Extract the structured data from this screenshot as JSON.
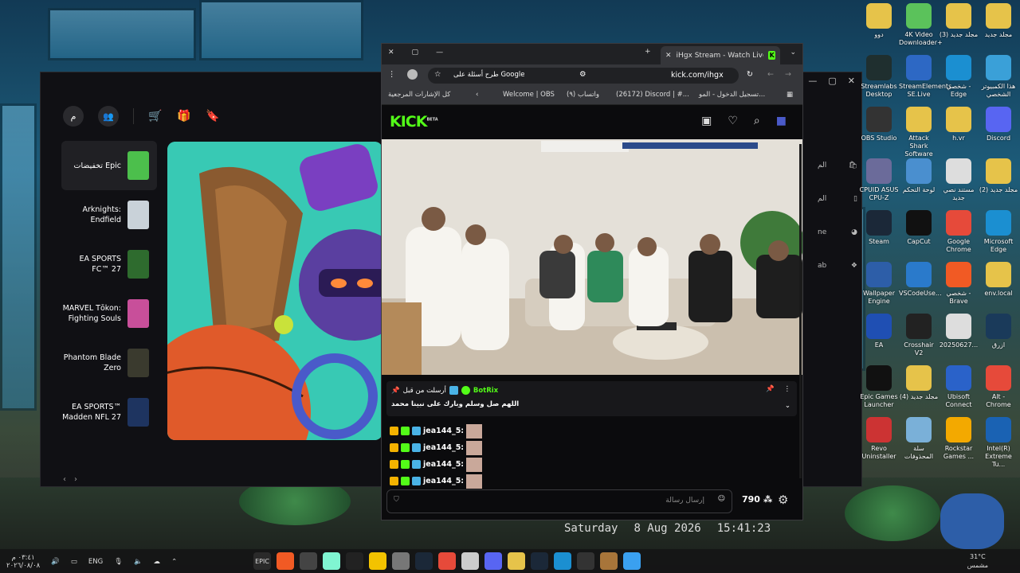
{
  "epic": {
    "avatar_initial": "م",
    "sidebar": [
      {
        "label": "تخفيضات Epic",
        "color": "#4cbf4c"
      },
      {
        "label": "Arknights: Endfield",
        "color": "#c9d2d9"
      },
      {
        "label": "EA SPORTS FC™ 27",
        "color": "#2e6b2e"
      },
      {
        "label": "MARVEL Tōkon: Fighting Souls",
        "color": "#c84f9a"
      },
      {
        "label": "Phantom Blade Zero",
        "color": "#3a3a2e"
      },
      {
        "label": "EA SPORTS™ Madden NFL 27",
        "color": "#1e3460"
      }
    ],
    "right_nav": [
      "الم",
      "الم",
      "ne",
      "ab"
    ],
    "window_controls": [
      "—",
      "▢",
      "✕"
    ]
  },
  "chrome": {
    "tab_title": "iHgx Stream - Watch Live on Ki",
    "url": "kick.com/ihgx",
    "google_chip": "طرح أسئلة على Google",
    "bookmarks": [
      "كل الإشارات المرجعية",
      "Welcome | OBS",
      "(٩) واتساب",
      "(26172) Discord | #...",
      "تسجيل الدخول - المو..."
    ],
    "window_controls": [
      "✕",
      "▢",
      "—"
    ]
  },
  "kick": {
    "logo": "KICK",
    "logo_badge": "BETA",
    "pinned": {
      "pinned_by": "أرسلت من قبل",
      "bot": "BotRix",
      "message": "اللهم صل وسلم وبارك على نبينا محمد"
    },
    "chat": [
      {
        "user": "jea144_5:"
      },
      {
        "user": "jea144_5:"
      },
      {
        "user": "jea144_5:"
      },
      {
        "user": "jea144_5:"
      }
    ],
    "input_placeholder": "إرسال رسالة",
    "viewers": "790"
  },
  "desktop_icons": [
    {
      "label": "دوو",
      "color": "#e6c34a",
      "col": 0,
      "row": 0
    },
    {
      "label": "4K Video Downloader+",
      "color": "#5bc25b",
      "col": 1,
      "row": 0
    },
    {
      "label": "(3) مجلد جديد",
      "color": "#e6c34a",
      "col": 2,
      "row": 0
    },
    {
      "label": "مجلد جديد",
      "color": "#e6c34a",
      "col": 3,
      "row": 0
    },
    {
      "label": "Streamlabs Desktop",
      "color": "#1f2f2f",
      "col": 0,
      "row": 1
    },
    {
      "label": "StreamElements SE.Live",
      "color": "#2d68c4",
      "col": 1,
      "row": 1
    },
    {
      "label": "شخصي - Edge",
      "color": "#1b8fd1",
      "col": 2,
      "row": 1
    },
    {
      "label": "هذا الكمبيوتر الشخصي",
      "color": "#3aa0d8",
      "col": 3,
      "row": 1
    },
    {
      "label": "OBS Studio",
      "color": "#333",
      "col": 0,
      "row": 2
    },
    {
      "label": "Attack Shark Software",
      "color": "#e6c34a",
      "col": 1,
      "row": 2
    },
    {
      "label": "h.vr",
      "color": "#e6c34a",
      "col": 2,
      "row": 2
    },
    {
      "label": "Discord",
      "color": "#5865f2",
      "col": 3,
      "row": 2
    },
    {
      "label": "CPUID ASUS CPU-Z",
      "color": "#6b6b9a",
      "col": 0,
      "row": 3
    },
    {
      "label": "لوحة التحكم",
      "color": "#4a8fcf",
      "col": 1,
      "row": 3
    },
    {
      "label": "مستند نصي جديد",
      "color": "#ddd",
      "col": 2,
      "row": 3
    },
    {
      "label": "(2) مجلد جديد",
      "color": "#e6c34a",
      "col": 3,
      "row": 3
    },
    {
      "label": "Steam",
      "color": "#1b2838",
      "col": 0,
      "row": 4
    },
    {
      "label": "CapCut",
      "color": "#111",
      "col": 1,
      "row": 4
    },
    {
      "label": "Google Chrome",
      "color": "#e64a3a",
      "col": 2,
      "row": 4
    },
    {
      "label": "Microsoft Edge",
      "color": "#1b8fd1",
      "col": 3,
      "row": 4
    },
    {
      "label": "Wallpaper Engine",
      "color": "#2d5ea8",
      "col": 0,
      "row": 5
    },
    {
      "label": "VSCodeUse...",
      "color": "#2a7acb",
      "col": 1,
      "row": 5
    },
    {
      "label": "شخصي - Brave",
      "color": "#f15a24",
      "col": 2,
      "row": 5
    },
    {
      "label": "env.local",
      "color": "#e6c34a",
      "col": 3,
      "row": 5
    },
    {
      "label": "EA",
      "color": "#1f4fb3",
      "col": 0,
      "row": 6
    },
    {
      "label": "Crosshair V2",
      "color": "#222",
      "col": 1,
      "row": 6
    },
    {
      "label": "20250627...",
      "color": "#ddd",
      "col": 2,
      "row": 6
    },
    {
      "label": "ازرق",
      "color": "#1a3a5a",
      "col": 3,
      "row": 6
    },
    {
      "label": "Epic Games Launcher",
      "color": "#111",
      "col": 0,
      "row": 7
    },
    {
      "label": "(4) مجلد جديد",
      "color": "#e6c34a",
      "col": 1,
      "row": 7
    },
    {
      "label": "Ubisoft Connect",
      "color": "#2a62c9",
      "col": 2,
      "row": 7
    },
    {
      "label": "Alt - Chrome",
      "color": "#e64a3a",
      "col": 3,
      "row": 7
    },
    {
      "label": "Revo Uninstaller",
      "color": "#c33",
      "col": 0,
      "row": 8
    },
    {
      "label": "سلة المحذوفات",
      "color": "#7ab0d8",
      "col": 1,
      "row": 8
    },
    {
      "label": "Rockstar Games ...",
      "color": "#f3a900",
      "col": 2,
      "row": 8
    },
    {
      "label": "Intel(R) Extreme Tu...",
      "color": "#1a62b3",
      "col": 3,
      "row": 8
    }
  ],
  "clock": {
    "day": "Saturday",
    "date": "8 Aug 2026",
    "time": "15:41:23"
  },
  "taskbar": {
    "time": "٠٣:٤١ م",
    "date": "٢٠٢٦/٠٨/٠٨",
    "lang": "ENG",
    "weather_temp": "31°C",
    "weather_text": "مشمس",
    "apps": [
      {
        "name": "epic",
        "label": "EPIC",
        "color": "#2a2a2a"
      },
      {
        "name": "brave",
        "label": "",
        "color": "#f15a24"
      },
      {
        "name": "obs",
        "label": "",
        "color": "#444"
      },
      {
        "name": "streamlabs",
        "label": "",
        "color": "#80f5d2"
      },
      {
        "name": "capcut",
        "label": "",
        "color": "#222"
      },
      {
        "name": "attack-shark",
        "label": "",
        "color": "#f3c300"
      },
      {
        "name": "files",
        "label": "",
        "color": "#777"
      },
      {
        "name": "steam",
        "label": "",
        "color": "#1b2838"
      },
      {
        "name": "chrome",
        "label": "",
        "color": "#e64a3a"
      },
      {
        "name": "store",
        "label": "",
        "color": "#ccc"
      },
      {
        "name": "discord",
        "label": "",
        "color": "#5865f2"
      },
      {
        "name": "explorer",
        "label": "",
        "color": "#e6c34a"
      },
      {
        "name": "steam-2",
        "label": "",
        "color": "#1b2838"
      },
      {
        "name": "edge",
        "label": "",
        "color": "#1b8fd1"
      },
      {
        "name": "terminal",
        "label": "",
        "color": "#333"
      },
      {
        "name": "food",
        "label": "",
        "color": "#a8753a"
      },
      {
        "name": "windows",
        "label": "",
        "color": "#3aa0f0"
      }
    ]
  }
}
